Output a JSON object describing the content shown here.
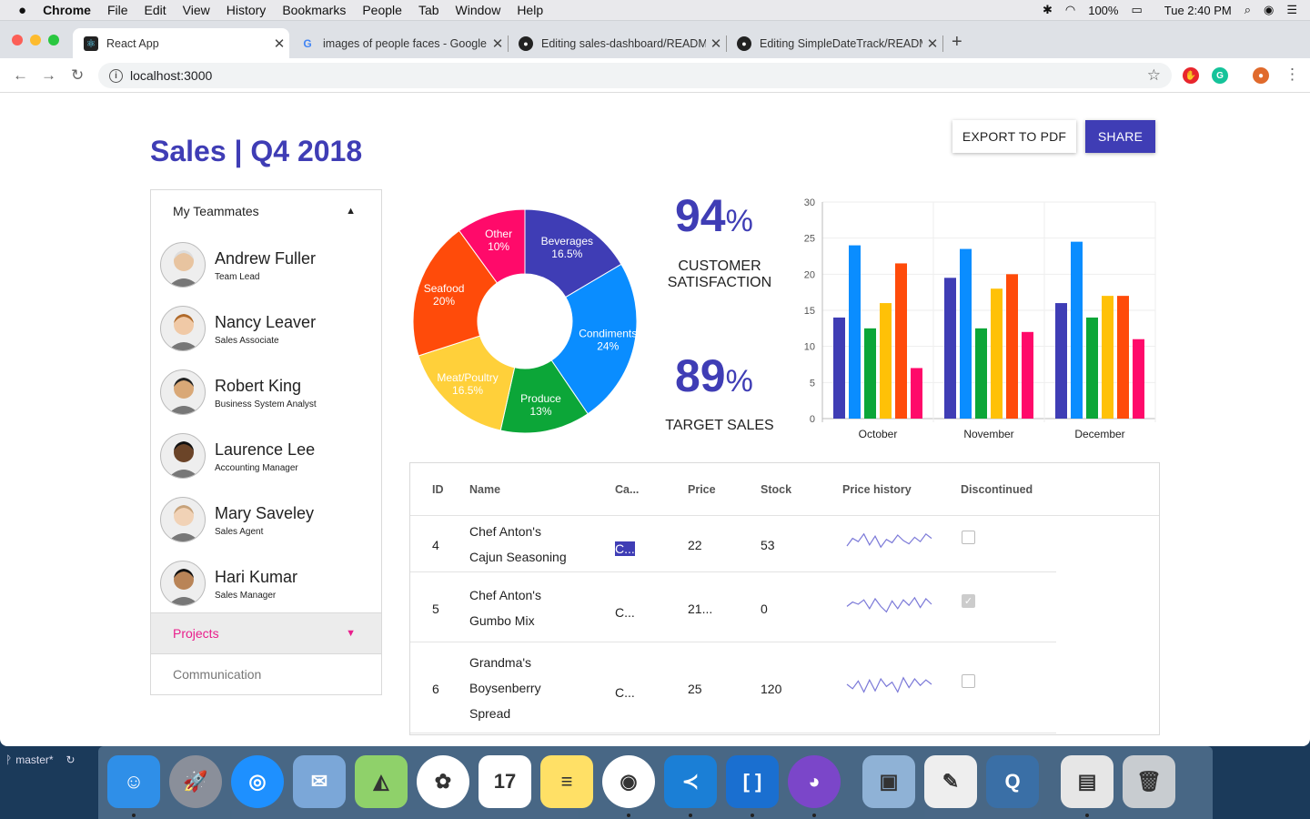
{
  "menubar": {
    "app": "Chrome",
    "items": [
      "File",
      "Edit",
      "View",
      "History",
      "Bookmarks",
      "People",
      "Tab",
      "Window",
      "Help"
    ],
    "battery": "100%",
    "clock": "Tue 2:40 PM"
  },
  "tabs": [
    {
      "title": "React App",
      "icon": "react-icon"
    },
    {
      "title": "images of people faces - Google",
      "icon": "google-icon"
    },
    {
      "title": "Editing sales-dashboard/README",
      "icon": "github-icon"
    },
    {
      "title": "Editing SimpleDateTrack/README",
      "icon": "github-icon"
    }
  ],
  "address": {
    "url": "localhost:3000"
  },
  "header": {
    "title": "Sales | Q4 2018",
    "export_label": "EXPORT TO PDF",
    "share_label": "SHARE"
  },
  "teammates": {
    "heading": "My Teammates",
    "members": [
      {
        "name": "Andrew Fuller",
        "role": "Team Lead"
      },
      {
        "name": "Nancy Leaver",
        "role": "Sales Associate"
      },
      {
        "name": "Robert King",
        "role": "Business System Analyst"
      },
      {
        "name": "Laurence Lee",
        "role": "Accounting Manager"
      },
      {
        "name": "Mary Saveley",
        "role": "Sales Agent"
      },
      {
        "name": "Hari Kumar",
        "role": "Sales Manager"
      }
    ],
    "projects_label": "Projects",
    "communication_label": "Communication"
  },
  "kpis": [
    {
      "value": "94",
      "unit": "%",
      "label_lines": [
        "CUSTOMER",
        "SATISFACTION"
      ]
    },
    {
      "value": "89",
      "unit": "%",
      "label_lines": [
        "TARGET SALES"
      ]
    }
  ],
  "colors": {
    "accent": "#3f3db5",
    "pink": "#e91e63"
  },
  "chart_data": [
    {
      "type": "pie",
      "donut": true,
      "slices": [
        {
          "label": "Beverages",
          "value": 16.5,
          "text": "16.5%",
          "color": "#3f3db5"
        },
        {
          "label": "Condiments",
          "value": 24,
          "text": "24%",
          "color": "#0a8dff"
        },
        {
          "label": "Produce",
          "value": 13,
          "text": "13%",
          "color": "#0ca638"
        },
        {
          "label": "Meat/Poultry",
          "value": 16.5,
          "text": "16.5%",
          "color": "#ffd03a"
        },
        {
          "label": "Seafood",
          "value": 20,
          "text": "20%",
          "color": "#ff4b0a"
        },
        {
          "label": "Other",
          "value": 10,
          "text": "10%",
          "color": "#ff0a6a"
        }
      ]
    },
    {
      "type": "bar",
      "categories": [
        "October",
        "November",
        "December"
      ],
      "ylim": [
        0,
        30
      ],
      "yticks": [
        0,
        5,
        10,
        15,
        20,
        25,
        30
      ],
      "grid": true,
      "colors": [
        "#3f3db5",
        "#0a8dff",
        "#0ca638",
        "#ffc107",
        "#ff4b0a",
        "#ff0a6a"
      ],
      "series": [
        {
          "values": [
            14,
            19.5,
            16
          ]
        },
        {
          "values": [
            24,
            23.5,
            24.5
          ]
        },
        {
          "values": [
            12.5,
            12.5,
            14
          ]
        },
        {
          "values": [
            16,
            18,
            17
          ]
        },
        {
          "values": [
            21.5,
            20,
            17
          ]
        },
        {
          "values": [
            7,
            12,
            11
          ]
        }
      ]
    }
  ],
  "grid": {
    "columns": [
      "ID",
      "Name",
      "Ca...",
      "Price",
      "Stock",
      "Price history",
      "Discontinued"
    ],
    "rows": [
      {
        "id": "4",
        "name_lines": [
          "Chef Anton's",
          "Cajun Seasoning"
        ],
        "category": "C...",
        "price": "22",
        "stock": "53",
        "spark": [
          5,
          12,
          9,
          16,
          6,
          14,
          4,
          11,
          8,
          15,
          10,
          7,
          13,
          9,
          16,
          12
        ],
        "discontinued": false,
        "selected": true
      },
      {
        "id": "5",
        "name_lines": [
          "Chef Anton's",
          "Gumbo Mix"
        ],
        "category": "C...",
        "price": "21...",
        "stock": "0",
        "spark": [
          8,
          12,
          10,
          14,
          6,
          15,
          8,
          3,
          13,
          6,
          14,
          9,
          16,
          7,
          15,
          10
        ],
        "discontinued": true,
        "selected": false
      },
      {
        "id": "6",
        "name_lines": [
          "Grandma's",
          "Boysenberry",
          "Spread"
        ],
        "category": "C...",
        "price": "25",
        "stock": "120",
        "spark": [
          10,
          6,
          13,
          3,
          14,
          4,
          15,
          8,
          12,
          3,
          16,
          7,
          15,
          9,
          14,
          10
        ],
        "discontinued": false,
        "selected": false
      }
    ]
  },
  "terminal": {
    "branch": "master*"
  },
  "dock": [
    {
      "name": "finder-icon",
      "color": "#2f8fe8",
      "glyph": "☺"
    },
    {
      "name": "launchpad-icon",
      "color": "#8a8f9a",
      "glyph": "🚀"
    },
    {
      "name": "safari-icon",
      "color": "#1e90ff",
      "glyph": "◎"
    },
    {
      "name": "mail-icon",
      "color": "#7ba7d8",
      "glyph": "✉"
    },
    {
      "name": "maps-icon",
      "color": "#8fd16a",
      "glyph": "◭"
    },
    {
      "name": "photos-icon",
      "color": "#ffffff",
      "glyph": "✿"
    },
    {
      "name": "calendar-icon",
      "color": "#ffffff",
      "glyph": "17"
    },
    {
      "name": "notes-icon",
      "color": "#ffe066",
      "glyph": "≡"
    },
    {
      "name": "chrome-icon",
      "color": "#ffffff",
      "glyph": "◉"
    },
    {
      "name": "vscode-icon",
      "color": "#1b7fd6",
      "glyph": "≺"
    },
    {
      "name": "brackets-icon",
      "color": "#1a6fd0",
      "glyph": "[ ]"
    },
    {
      "name": "github-desktop-icon",
      "color": "#7b46c9",
      "glyph": "◕"
    },
    {
      "name": "preview-icon",
      "color": "#8fb2d6",
      "glyph": "▣"
    },
    {
      "name": "textedit-icon",
      "color": "#eeeeee",
      "glyph": "✎"
    },
    {
      "name": "quicktime-icon",
      "color": "#3a6fa6",
      "glyph": "Q"
    },
    {
      "name": "window-icon",
      "color": "#e6e6e6",
      "glyph": "▤"
    },
    {
      "name": "trash-icon",
      "color": "#c8ccd0",
      "glyph": "🗑"
    }
  ]
}
